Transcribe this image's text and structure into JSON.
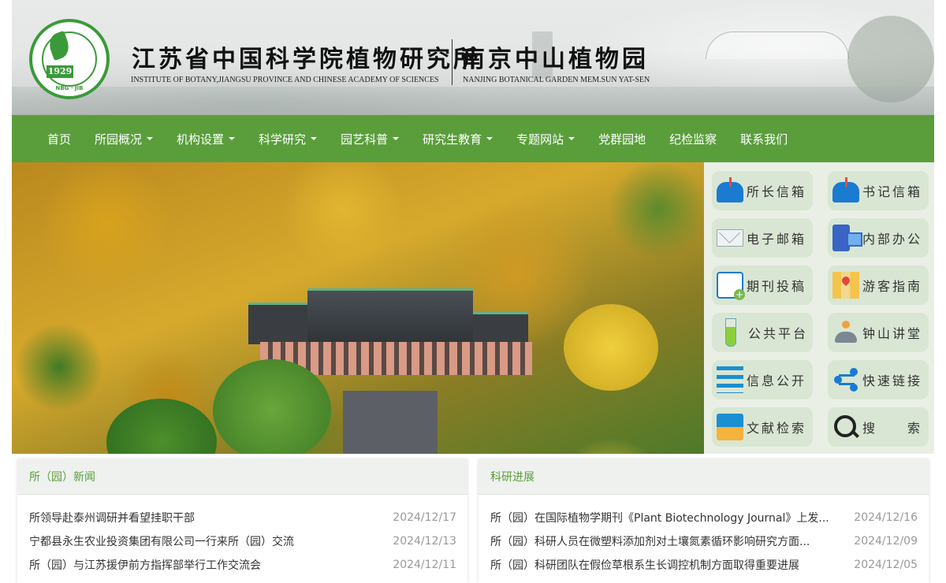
{
  "header": {
    "logo_year": "1929",
    "logo_ring_text": "NBG · JIB",
    "title_cn": "江苏省中国科学院植物研究所",
    "title_en": "INSTITUTE OF BOTANY,JIANGSU PROVINCE AND CHINESE ACADEMY OF SCIENCES",
    "garden_cn": "南京中山植物园",
    "garden_en": "NANJING BOTANICAL GARDEN MEM.SUN YAT-SEN"
  },
  "nav": {
    "items": [
      {
        "label": "首页",
        "dropdown": false
      },
      {
        "label": "所园概况",
        "dropdown": true
      },
      {
        "label": "机构设置",
        "dropdown": true
      },
      {
        "label": "科学研究",
        "dropdown": true
      },
      {
        "label": "园艺科普",
        "dropdown": true
      },
      {
        "label": "研究生教育",
        "dropdown": true
      },
      {
        "label": "专题网站",
        "dropdown": true
      },
      {
        "label": "党群园地",
        "dropdown": false
      },
      {
        "label": "纪检监察",
        "dropdown": false
      },
      {
        "label": "联系我们",
        "dropdown": false
      }
    ]
  },
  "quick_links": [
    {
      "label": "所长信箱",
      "icon": "mailbox-icon"
    },
    {
      "label": "书记信箱",
      "icon": "mailbox-icon"
    },
    {
      "label": "电子邮箱",
      "icon": "envelope-icon"
    },
    {
      "label": "内部办公",
      "icon": "computer-icon"
    },
    {
      "label": "期刊投稿",
      "icon": "document-add-icon"
    },
    {
      "label": "游客指南",
      "icon": "map-pin-icon"
    },
    {
      "label": "公共平台",
      "icon": "test-tube-icon"
    },
    {
      "label": "钟山讲堂",
      "icon": "lecture-icon"
    },
    {
      "label": "信息公开",
      "icon": "list-icon"
    },
    {
      "label": "快速链接",
      "icon": "share-icon"
    },
    {
      "label": "文献检索",
      "icon": "books-icon"
    },
    {
      "label": "搜　　索",
      "icon": "search-icon"
    }
  ],
  "news_panel": {
    "title": "所（园）新闻",
    "items": [
      {
        "title": "所领导赴泰州调研并看望挂职干部",
        "date": "2024/12/17"
      },
      {
        "title": "宁都县永生农业投资集团有限公司一行来所（园）交流",
        "date": "2024/12/13"
      },
      {
        "title": "所（园）与江苏援伊前方指挥部举行工作交流会",
        "date": "2024/12/11"
      }
    ]
  },
  "research_panel": {
    "title": "科研进展",
    "items": [
      {
        "title": "所（园）在国际植物学期刊《Plant Biotechnology Journal》上发...",
        "date": "2024/12/16"
      },
      {
        "title": "所（园）科研人员在微塑料添加剂对土壤氮素循环影响研究方面...",
        "date": "2024/12/09"
      },
      {
        "title": "所（园）科研团队在假俭草根系生长调控机制方面取得重要进展",
        "date": "2024/12/05"
      }
    ]
  },
  "colors": {
    "nav_green": "#5a9e3c",
    "quick_bg": "#e9efe5",
    "quick_button": "#d9e6d4"
  }
}
